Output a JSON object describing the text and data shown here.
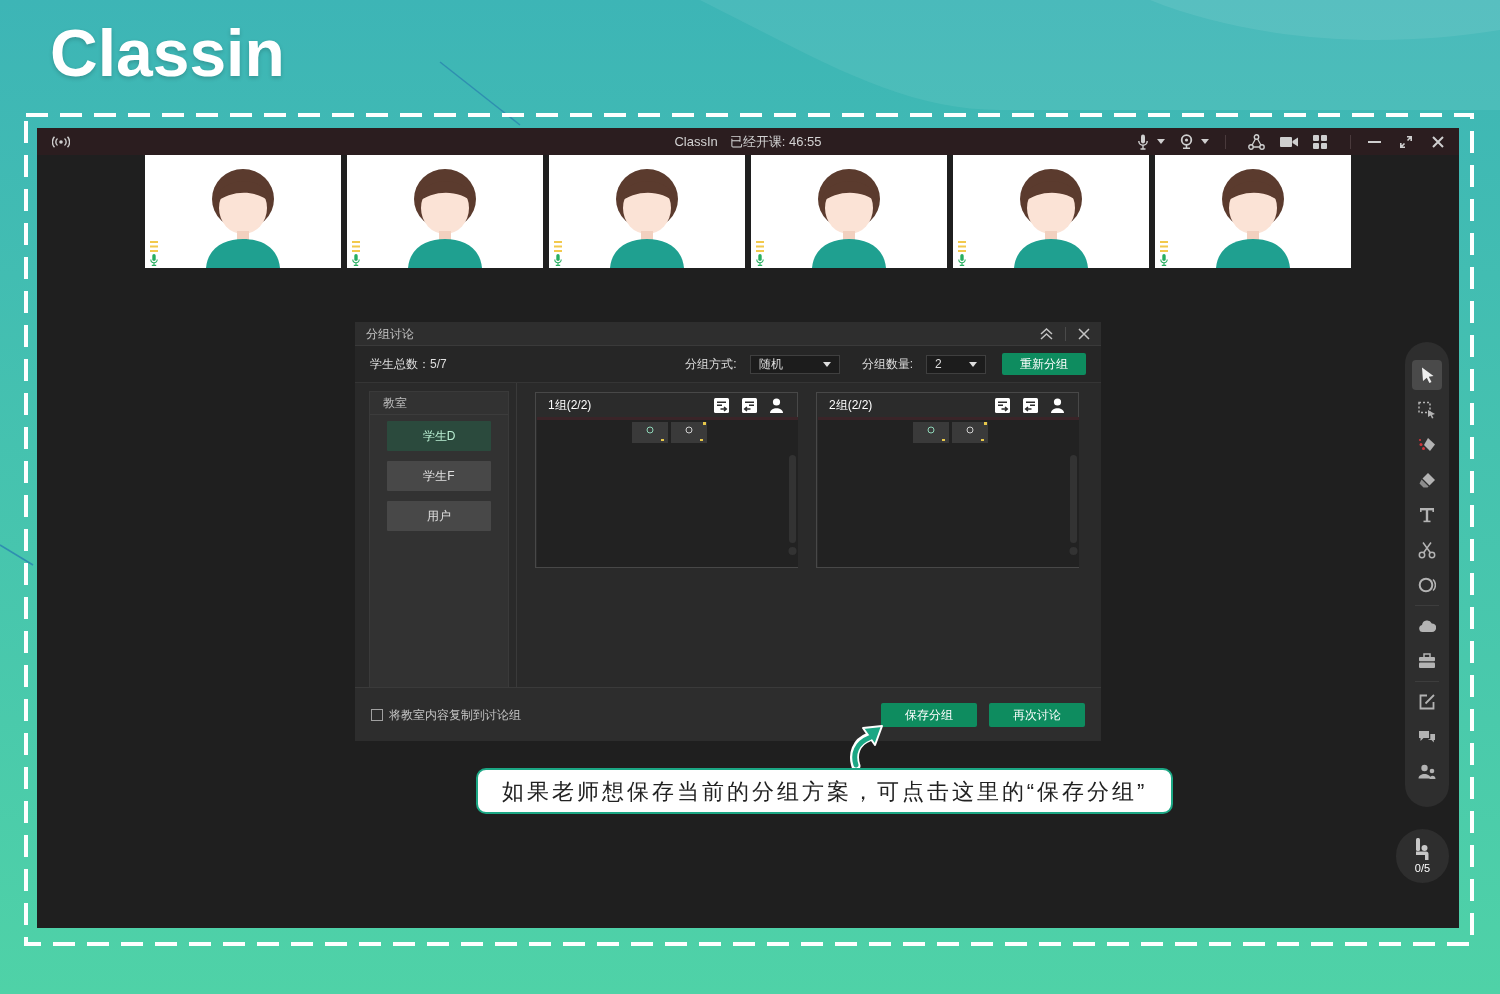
{
  "logo": {
    "text": "Classin"
  },
  "title_bar": {
    "app_name": "ClassIn",
    "class_timer": "已经开课: 46:55"
  },
  "video_tiles": [
    {
      "mic_on": true
    },
    {
      "mic_on": true
    },
    {
      "mic_on": true
    },
    {
      "mic_on": true
    },
    {
      "mic_on": true
    },
    {
      "mic_on": true
    }
  ],
  "dialog": {
    "title": "分组讨论",
    "student_total": "学生总数：5/7",
    "group_mode": {
      "label": "分组方式:",
      "value": "随机"
    },
    "group_count": {
      "label": "分组数量:",
      "value": "2"
    },
    "regroup_button": "重新分组",
    "classroom": {
      "title": "教室",
      "students": [
        {
          "name": "学生D",
          "selected": true
        },
        {
          "name": "学生F",
          "selected": false
        },
        {
          "name": "用户",
          "selected": false
        }
      ]
    },
    "groups": [
      {
        "title": "1组(2/2)"
      },
      {
        "title": "2组(2/2)"
      }
    ],
    "copy_option": {
      "label": "将教室内容复制到讨论组",
      "checked": false
    },
    "buttons": [
      "保存分组",
      "再次讨论"
    ]
  },
  "callout": {
    "text": "如果老师想保存当前的分组方案，可点击这里的“保存分组”"
  },
  "toolbar": {
    "groups": [
      {
        "tools": [
          {
            "kind": "pointer",
            "selected": true
          },
          {
            "kind": "area_select",
            "selected": false
          },
          {
            "kind": "marker",
            "selected": false
          },
          {
            "kind": "eraser",
            "selected": false
          },
          {
            "kind": "text",
            "selected": false
          },
          {
            "kind": "scissors",
            "selected": false
          },
          {
            "kind": "ring",
            "selected": false
          }
        ]
      },
      {
        "tools": [
          {
            "kind": "cloud",
            "selected": false
          },
          {
            "kind": "toolbox",
            "selected": false
          }
        ]
      },
      {
        "tools": [
          {
            "kind": "edit",
            "selected": false
          },
          {
            "kind": "chat",
            "selected": false
          },
          {
            "kind": "people",
            "selected": false
          }
        ]
      }
    ]
  },
  "hand_raise": {
    "count": "0/5"
  }
}
